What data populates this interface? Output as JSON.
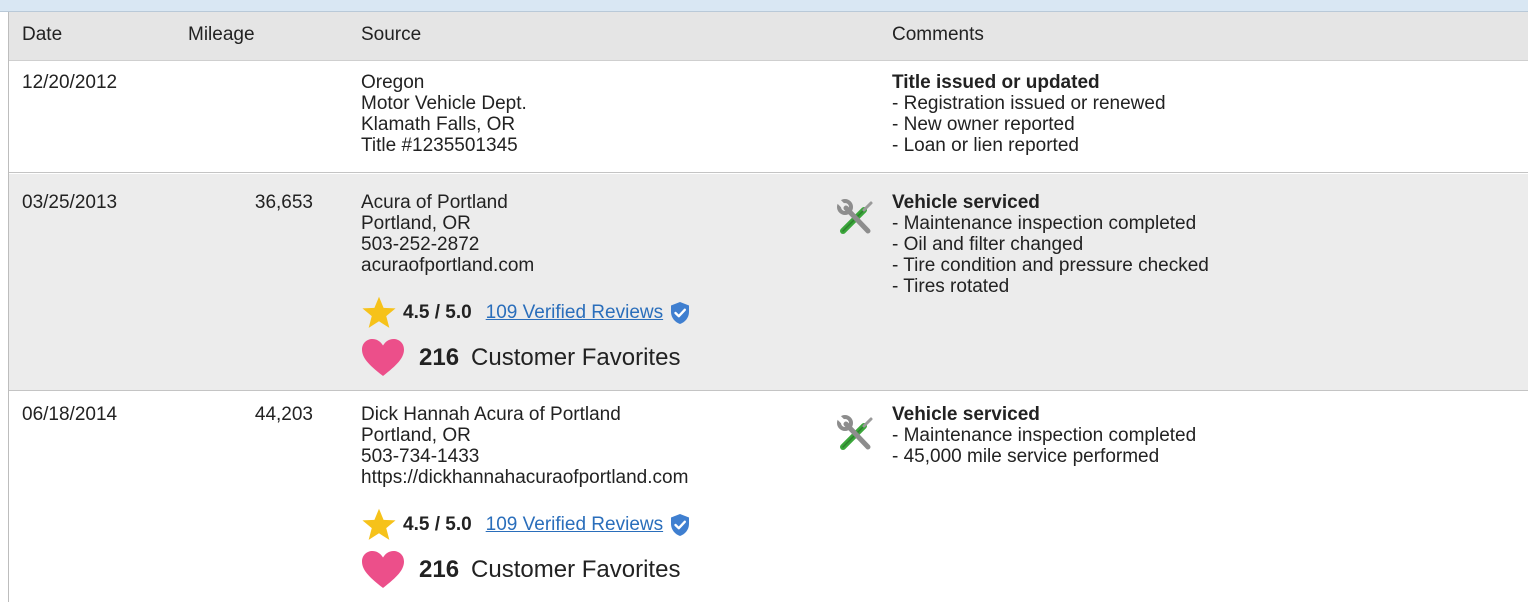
{
  "table": {
    "headers": {
      "date": "Date",
      "mileage": "Mileage",
      "source": "Source",
      "comments": "Comments"
    },
    "rows": [
      {
        "date": "12/20/2012",
        "mileage": "",
        "source": [
          "Oregon",
          "Motor Vehicle Dept.",
          "Klamath Falls, OR",
          "Title #1235501345"
        ],
        "comment_title": "Title issued or updated",
        "comments": [
          "- Registration issued or renewed",
          "- New owner reported",
          "- Loan or lien reported"
        ]
      },
      {
        "date": "03/25/2013",
        "mileage": "36,653",
        "source": [
          "Acura of Portland",
          "Portland, OR",
          "503-252-2872",
          "acuraofportland.com"
        ],
        "rating": "4.5 / 5.0",
        "rating_value": 4.5,
        "reviews_link": "109 Verified Reviews",
        "favorites_count": "216",
        "favorites_label": "Customer Favorites",
        "comment_title": "Vehicle serviced",
        "comments": [
          "- Maintenance inspection completed",
          "- Oil and filter changed",
          "- Tire condition and pressure checked",
          "- Tires rotated"
        ]
      },
      {
        "date": "06/18/2014",
        "mileage": "44,203",
        "source": [
          "Dick Hannah Acura of Portland",
          "Portland, OR",
          "503-734-1433",
          "https://dickhannahacuraofportland.com"
        ],
        "rating": "4.5 / 5.0",
        "rating_value": 4.5,
        "reviews_link": "109 Verified Reviews",
        "favorites_count": "216",
        "favorites_label": "Customer Favorites",
        "comment_title": "Vehicle serviced",
        "comments": [
          "- Maintenance inspection completed",
          "- 45,000 mile service performed"
        ]
      }
    ]
  },
  "icons": {
    "star": "star-icon",
    "shield": "verified-shield-icon",
    "heart": "heart-icon",
    "service": "wrench-screwdriver-icon"
  },
  "colors": {
    "header_bg": "#e5e5e5",
    "alt_row_bg": "#ececec",
    "link": "#2a6ebb",
    "star": "#f6c21a",
    "heart": "#ec4f8a",
    "shield": "#3f7fd0"
  }
}
